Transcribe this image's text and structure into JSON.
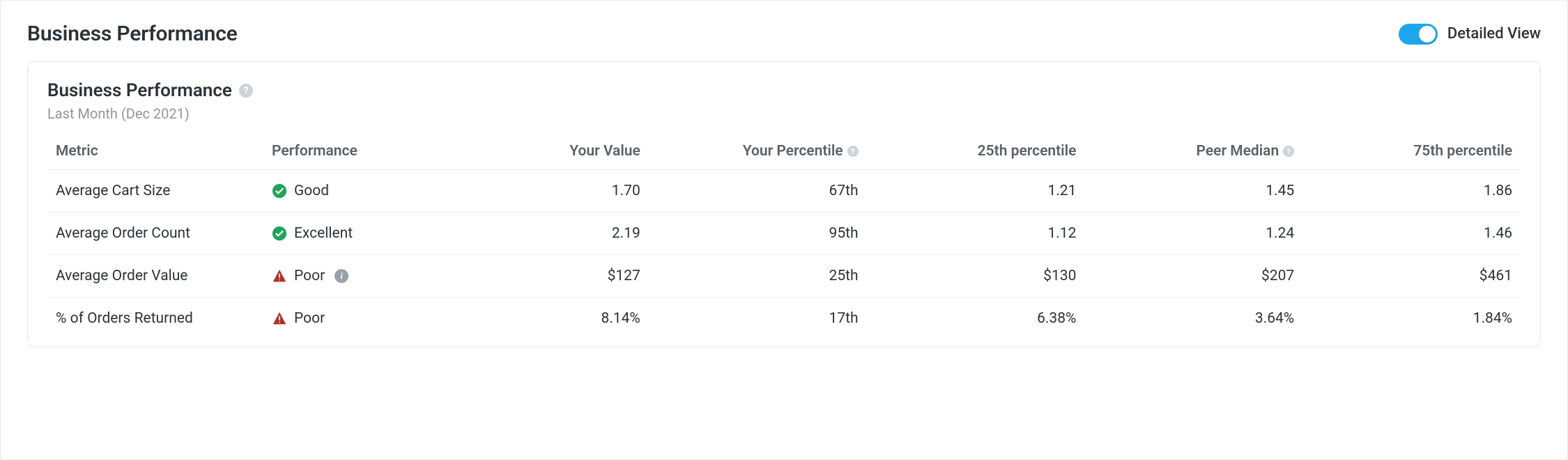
{
  "header": {
    "title": "Business Performance",
    "toggle_label": "Detailed View"
  },
  "card": {
    "title": "Business Performance",
    "subtitle": "Last Month (Dec 2021)"
  },
  "columns": {
    "metric": "Metric",
    "performance": "Performance",
    "your_value": "Your Value",
    "your_percentile": "Your Percentile",
    "p25": "25th percentile",
    "peer_median": "Peer Median",
    "p75": "75th percentile"
  },
  "rows": [
    {
      "metric": "Average Cart Size",
      "status": "good",
      "perf_label": "Good",
      "your_value": "1.70",
      "your_percentile": "67th",
      "p25": "1.21",
      "peer_median": "1.45",
      "p75": "1.86",
      "info": false
    },
    {
      "metric": "Average Order Count",
      "status": "good",
      "perf_label": "Excellent",
      "your_value": "2.19",
      "your_percentile": "95th",
      "p25": "1.12",
      "peer_median": "1.24",
      "p75": "1.46",
      "info": false
    },
    {
      "metric": "Average Order Value",
      "status": "poor",
      "perf_label": "Poor",
      "your_value": "$127",
      "your_percentile": "25th",
      "p25": "$130",
      "peer_median": "$207",
      "p75": "$461",
      "info": true
    },
    {
      "metric": "% of Orders Returned",
      "status": "poor",
      "perf_label": "Poor",
      "your_value": "8.14%",
      "your_percentile": "17th",
      "p25": "6.38%",
      "peer_median": "3.64%",
      "p75": "1.84%",
      "info": false
    }
  ]
}
